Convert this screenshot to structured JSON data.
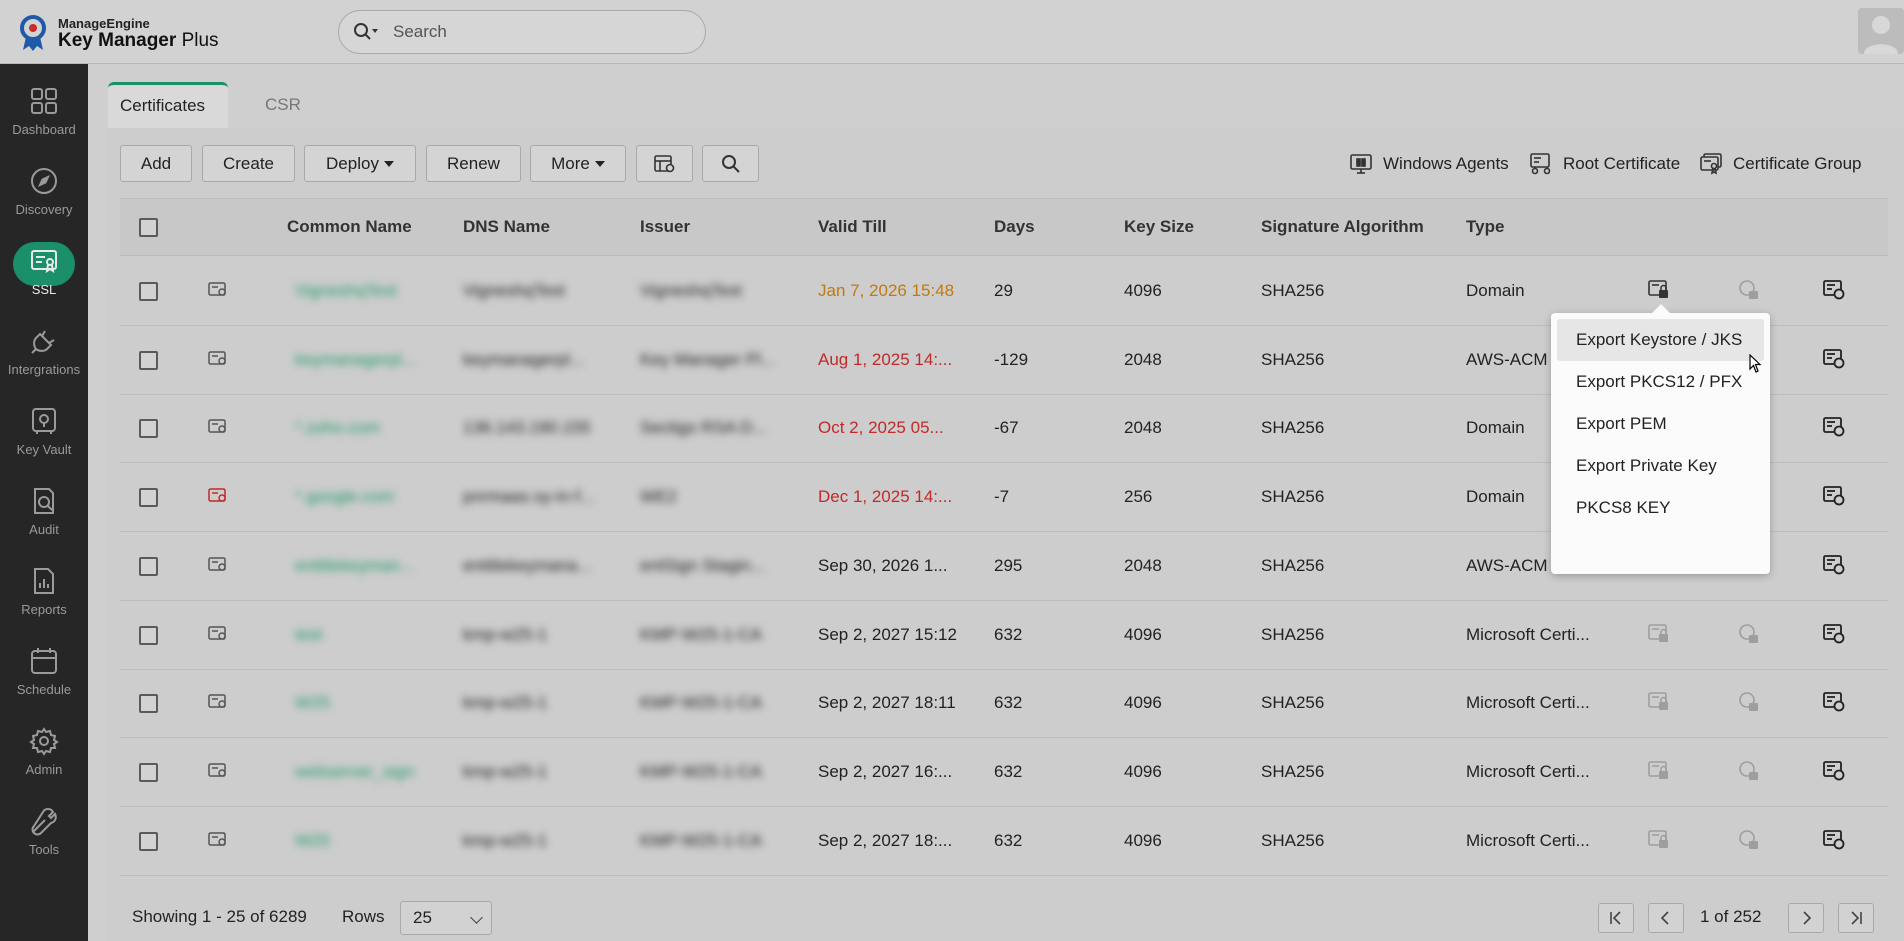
{
  "header": {
    "brand": "ManageEngine",
    "product_main": "Key Manager",
    "product_suffix": "Plus",
    "search_placeholder": "Search"
  },
  "sidebar": {
    "items": [
      {
        "label": "Dashboard",
        "icon": "dashboard-icon"
      },
      {
        "label": "Discovery",
        "icon": "compass-icon"
      },
      {
        "label": "SSL",
        "icon": "ssl-certificate-icon",
        "active": true
      },
      {
        "label": "Intergrations",
        "icon": "plug-icon"
      },
      {
        "label": "Key Vault",
        "icon": "vault-icon"
      },
      {
        "label": "Audit",
        "icon": "audit-icon"
      },
      {
        "label": "Reports",
        "icon": "reports-icon"
      },
      {
        "label": "Schedule",
        "icon": "calendar-icon"
      },
      {
        "label": "Admin",
        "icon": "gear-icon"
      },
      {
        "label": "Tools",
        "icon": "tools-icon"
      }
    ]
  },
  "tabs": [
    {
      "label": "Certificates",
      "active": true
    },
    {
      "label": "CSR",
      "active": false
    }
  ],
  "toolbar": {
    "add": "Add",
    "create": "Create",
    "deploy": "Deploy",
    "renew": "Renew",
    "more": "More",
    "windows_agents": "Windows Agents",
    "root_certificate": "Root Certificate",
    "certificate_group": "Certificate Group"
  },
  "table": {
    "columns": [
      "Common Name",
      "DNS Name",
      "Issuer",
      "Valid Till",
      "Days",
      "Key Size",
      "Signature Algorithm",
      "Type"
    ],
    "rows": [
      {
        "common_name": "VigneshqTest",
        "dns_name": "VigneshqTest",
        "issuer": "VigneshqTest",
        "valid_till": "Jan 7, 2026 15:48",
        "days": "29",
        "key_size": "4096",
        "algorithm": "SHA256",
        "type": "Domain",
        "status": "warning"
      },
      {
        "common_name": "keymanagerpl...",
        "dns_name": "keymanagerpl...",
        "issuer": "Key Manager Pl...",
        "valid_till": "Aug 1, 2025 14:...",
        "days": "-129",
        "key_size": "2048",
        "algorithm": "SHA256",
        "type": "AWS-ACM",
        "status": "expired"
      },
      {
        "common_name": "*.zoho.com",
        "dns_name": "136.143.190.155",
        "issuer": "Sectigo RSA D...",
        "valid_till": "Oct 2, 2025 05...",
        "days": "-67",
        "key_size": "2048",
        "algorithm": "SHA256",
        "type": "Domain",
        "status": "expired"
      },
      {
        "common_name": "*.google.com",
        "dns_name": "pnrmaas.sy-in-f...",
        "issuer": "WE2",
        "valid_till": "Dec 1, 2025 14:...",
        "days": "-7",
        "key_size": "256",
        "algorithm": "SHA256",
        "type": "Domain",
        "status": "expired"
      },
      {
        "common_name": "entitlekeyman...",
        "dns_name": "entitlekeymana...",
        "issuer": "entSign Stagin...",
        "valid_till": "Sep 30, 2026 1...",
        "days": "295",
        "key_size": "2048",
        "algorithm": "SHA256",
        "type": "AWS-ACM",
        "status": "normal"
      },
      {
        "common_name": "test",
        "dns_name": "kmp-w25-1",
        "issuer": "KMP-W25-1-CA",
        "valid_till": "Sep 2, 2027 15:12",
        "days": "632",
        "key_size": "4096",
        "algorithm": "SHA256",
        "type": "Microsoft Certi...",
        "status": "normal"
      },
      {
        "common_name": "W25",
        "dns_name": "kmp-w25-1",
        "issuer": "KMP-W25-1-CA",
        "valid_till": "Sep 2, 2027 18:11",
        "days": "632",
        "key_size": "4096",
        "algorithm": "SHA256",
        "type": "Microsoft Certi...",
        "status": "normal"
      },
      {
        "common_name": "webserver_sign",
        "dns_name": "kmp-w25-1",
        "issuer": "KMP-W25-1-CA",
        "valid_till": "Sep 2, 2027 16:...",
        "days": "632",
        "key_size": "4096",
        "algorithm": "SHA256",
        "type": "Microsoft Certi...",
        "status": "normal"
      },
      {
        "common_name": "W25",
        "dns_name": "kmp-w25-1",
        "issuer": "KMP-W25-1-CA",
        "valid_till": "Sep 2, 2027 18:...",
        "days": "632",
        "key_size": "4096",
        "algorithm": "SHA256",
        "type": "Microsoft Certi...",
        "status": "normal"
      }
    ]
  },
  "dropdown": {
    "items": [
      "Export Keystore / JKS",
      "Export PKCS12 / PFX",
      "Export PEM",
      "Export Private Key",
      "PKCS8 KEY"
    ]
  },
  "footer": {
    "showing": "Showing 1 - 25 of 6289",
    "rows_label": "Rows",
    "rows_value": "25",
    "page_info": "1 of 252"
  },
  "colors": {
    "accent": "#1a8f6a",
    "link_green": "#1f9a6a",
    "warning": "#c07a10",
    "expired": "#c02a2a",
    "sidebar_bg": "#262626"
  }
}
